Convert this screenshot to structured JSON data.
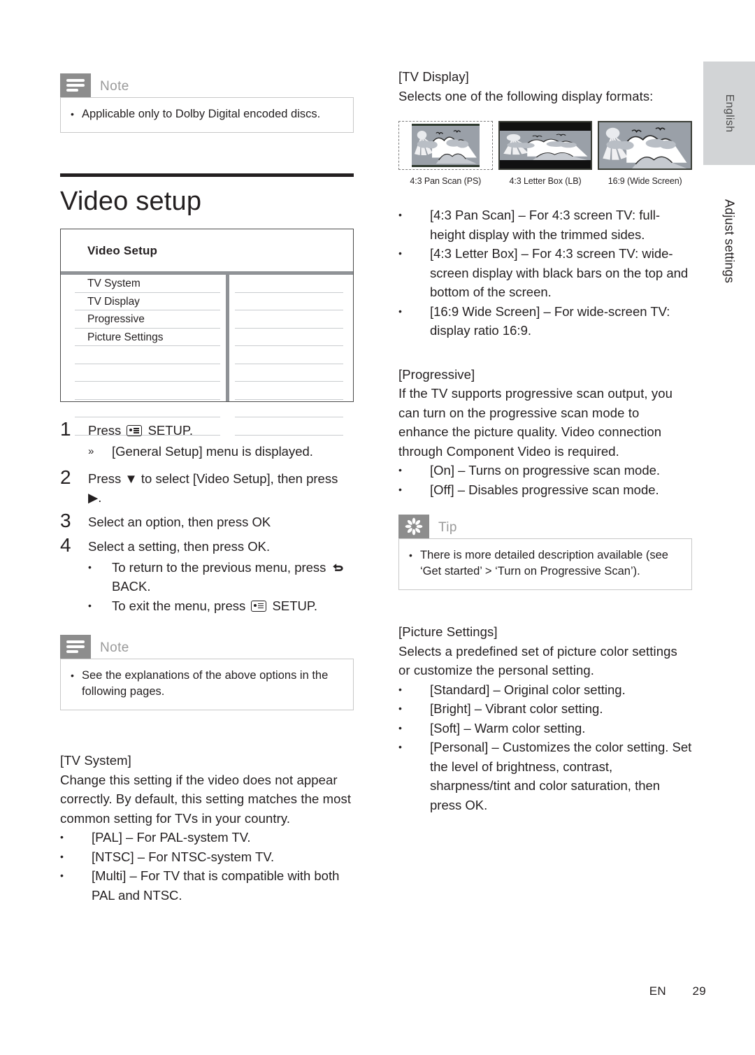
{
  "left_column": {
    "note_top": {
      "icon": "note-lines-icon",
      "title": "Note",
      "items": [
        "Applicable only to Dolby Digital encoded discs."
      ]
    },
    "section_heading": "Video setup",
    "osd_menu": {
      "title": "Video Setup",
      "items": [
        "TV System",
        "TV Display",
        "Progressive",
        "Picture Settings"
      ],
      "empty_rows": 5
    },
    "steps": [
      {
        "num": "1",
        "text_before_icon": "Press ",
        "icon": "setup-icon",
        "text_after_icon": " SETUP.",
        "sub_arrow": {
          "marker": "»",
          "text": "[General Setup] menu is displayed."
        }
      },
      {
        "num": "2",
        "text": "Press ▼ to select [Video Setup], then press ▶."
      },
      {
        "num": "3",
        "text": "Select an option, then press OK"
      },
      {
        "num": "4",
        "text": "Select a setting, then press OK.",
        "sub_bullets": [
          {
            "before": "To return to the previous menu, press ",
            "icon": "back-arrow-icon",
            "after": " BACK."
          },
          {
            "before": "To exit the menu, press ",
            "icon": "setup-icon",
            "after": " SETUP."
          }
        ]
      }
    ],
    "note_bottom": {
      "icon": "note-lines-icon",
      "title": "Note",
      "items": [
        "See the explanations of the above options in the following pages."
      ]
    },
    "tv_system": {
      "heading": "[TV System]",
      "body": "Change this setting if the video does not appear correctly. By default, this setting matches the most common setting for TVs in your country.",
      "bullets": [
        "[PAL] – For PAL-system TV.",
        "[NTSC] – For NTSC-system TV.",
        "[Multi] – For TV that is compatible with both PAL and NTSC."
      ]
    }
  },
  "right_column": {
    "tv_display": {
      "heading": "[TV Display]",
      "intro": "Selects one of the following display formats:",
      "figures": [
        {
          "caption": "4:3 Pan Scan (PS)",
          "kind": "ps"
        },
        {
          "caption": "4:3 Letter Box (LB)",
          "kind": "lb"
        },
        {
          "caption": "16:9 (Wide Screen)",
          "kind": "ws"
        }
      ],
      "bullets": [
        "[4:3 Pan Scan] – For 4:3 screen TV: full-height display with the trimmed sides.",
        "[4:3 Letter Box] – For 4:3 screen TV: wide-screen display with black bars on the top and bottom of the screen.",
        "[16:9 Wide Screen] – For wide-screen TV: display ratio 16:9."
      ]
    },
    "progressive": {
      "heading": "[Progressive]",
      "body": "If the TV supports progressive scan output, you can turn on the progressive scan mode to enhance the picture quality. Video connection through Component Video is required.",
      "bullets": [
        "[On] – Turns on progressive scan mode.",
        "[Off] – Disables progressive scan mode."
      ]
    },
    "tip": {
      "icon": "asterisk-icon",
      "title": "Tip",
      "items": [
        "There is more detailed description available (see ‘Get started’ > ‘Turn on Progressive Scan’)."
      ]
    },
    "picture_settings": {
      "heading": "[Picture Settings]",
      "body": "Selects a predefined set of picture color settings or customize the personal setting.",
      "bullets": [
        "[Standard] – Original color setting.",
        "[Bright] – Vibrant color setting.",
        "[Soft] – Warm color setting.",
        "[Personal] – Customizes the color setting. Set the level of brightness, contrast, sharpness/tint and color saturation, then press OK."
      ]
    }
  },
  "side_tabs": {
    "language": "English",
    "chapter": "Adjust settings"
  },
  "footer": {
    "lang_code": "EN",
    "page_number": "29"
  },
  "colors": {
    "badge_gray": "#8d8d8d",
    "callout_title_gray": "#9a9a9a",
    "tab_gray": "#d2d4d6",
    "osd_separator": "#8f9296",
    "text": "#231f20"
  }
}
